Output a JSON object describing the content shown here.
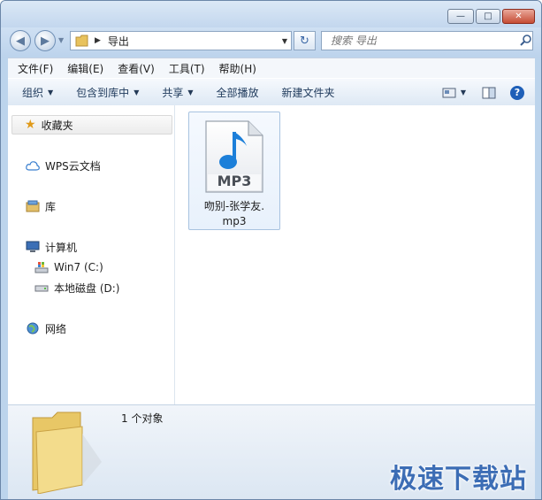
{
  "titlebar": {
    "minimize_label": "—",
    "maximize_label": "□",
    "close_label": "✕"
  },
  "navigation": {
    "back_icon": "back-arrow-icon",
    "forward_icon": "forward-arrow-icon",
    "address_path": "导出",
    "search_placeholder": "搜索 导出"
  },
  "menu": {
    "items": [
      "文件(F)",
      "编辑(E)",
      "查看(V)",
      "工具(T)",
      "帮助(H)"
    ]
  },
  "toolbar": {
    "organize": "组织",
    "include_in_library": "包含到库中",
    "share": "共享",
    "play_all": "全部播放",
    "new_folder": "新建文件夹",
    "help_glyph": "?"
  },
  "sidebar": {
    "favorites": "收藏夹",
    "wps_cloud": "WPS云文档",
    "libraries": "库",
    "computer": "计算机",
    "drive_c": "Win7 (C:)",
    "drive_d": "本地磁盘 (D:)",
    "network": "网络"
  },
  "files": [
    {
      "name_line1": "吻别-张学友.",
      "name_line2": "mp3",
      "type_badge": "MP3"
    }
  ],
  "details": {
    "count_text": "1 个对象"
  },
  "watermark": {
    "text": "极速下载站"
  },
  "colors": {
    "frame": "#bcd4ec",
    "accent_blue": "#1c7fd9",
    "watermark": "#3c6db5"
  }
}
